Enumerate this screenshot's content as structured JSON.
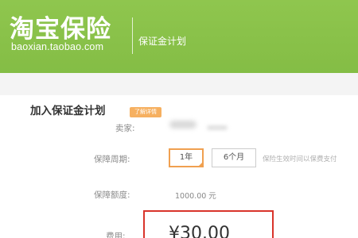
{
  "header": {
    "logo_title": "淘宝保险",
    "logo_url": "baoxian.taobao.com",
    "subtitle": "保证金计划"
  },
  "form": {
    "section_title": "加入保证金计划",
    "tag": "了解详情",
    "seller_label": "卖家:",
    "period_label": "保障周期:",
    "period_options": [
      "1年",
      "6个月"
    ],
    "period_selected": "1年",
    "period_note": "保险生效时间以保费支付",
    "amount_label": "保障额度:",
    "amount_value": "1000.00 元",
    "fee_label": "费用:",
    "fee_value": "¥30.00"
  },
  "colors": {
    "header_green": "#8bc34a",
    "selected_border": "#f0a050",
    "highlight_box": "#d9342b",
    "tag_bg": "#f6b060"
  }
}
